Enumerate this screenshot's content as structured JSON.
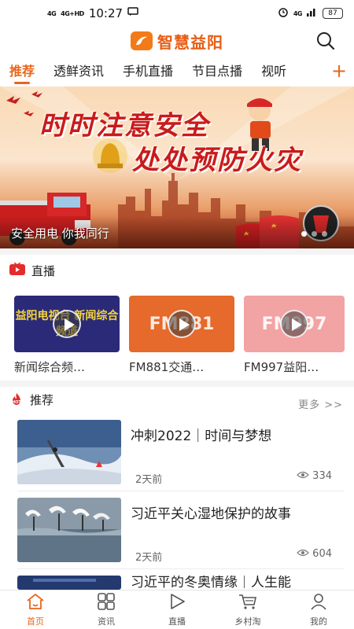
{
  "status_bar": {
    "signal_left": "4G",
    "signal_right": "4G+HD",
    "time": "10:27",
    "notification_icon": "message-icon",
    "alarm_icon": "alarm-icon",
    "network": "4G",
    "battery": "87"
  },
  "header": {
    "app_title": "智慧益阳",
    "logo_icon": "app-logo-icon",
    "search_icon": "search-icon"
  },
  "tabs": {
    "items": [
      {
        "label": "推荐",
        "active": true
      },
      {
        "label": "透鲜资讯",
        "active": false
      },
      {
        "label": "手机直播",
        "active": false
      },
      {
        "label": "节目点播",
        "active": false
      },
      {
        "label": "视听",
        "active": false
      }
    ],
    "add_label": "+"
  },
  "banner": {
    "headline_1": "时时注意安全",
    "headline_2": "处处预防火灾",
    "caption": "安全用电 你我同行",
    "slide_count": 3,
    "active_slide": 1
  },
  "live": {
    "section_label": "直播",
    "items": [
      {
        "name": "新闻综合频…",
        "thumb_text": "益阳电视台 新闻综合频道",
        "bg": "#2a2a78"
      },
      {
        "name": "FM881交通…",
        "thumb_text": "FM881",
        "bg": "#e56a2c"
      },
      {
        "name": "FM997益阳…",
        "thumb_text": "FM997",
        "bg": "#f2a3a3"
      }
    ]
  },
  "recommend": {
    "section_label": "推荐",
    "hot_badge": "HOT",
    "more_label": "更多 >>",
    "items": [
      {
        "title": "冲刺2022｜时间与梦想",
        "date": "2天前",
        "views": "334"
      },
      {
        "title": "习近平关心湿地保护的故事",
        "date": "2天前",
        "views": "604"
      },
      {
        "title": "习近平的冬奥情缘｜人生能",
        "date": "",
        "views": ""
      }
    ]
  },
  "bottom_nav": {
    "items": [
      {
        "label": "首页",
        "icon": "home-icon",
        "active": true
      },
      {
        "label": "资讯",
        "icon": "grid-icon",
        "active": false
      },
      {
        "label": "直播",
        "icon": "play-icon",
        "active": false
      },
      {
        "label": "乡村淘",
        "icon": "cart-icon",
        "active": false
      },
      {
        "label": "我的",
        "icon": "user-icon",
        "active": false
      }
    ]
  },
  "colors": {
    "accent": "#e8661a",
    "live_icon_red": "#e52b2b"
  }
}
